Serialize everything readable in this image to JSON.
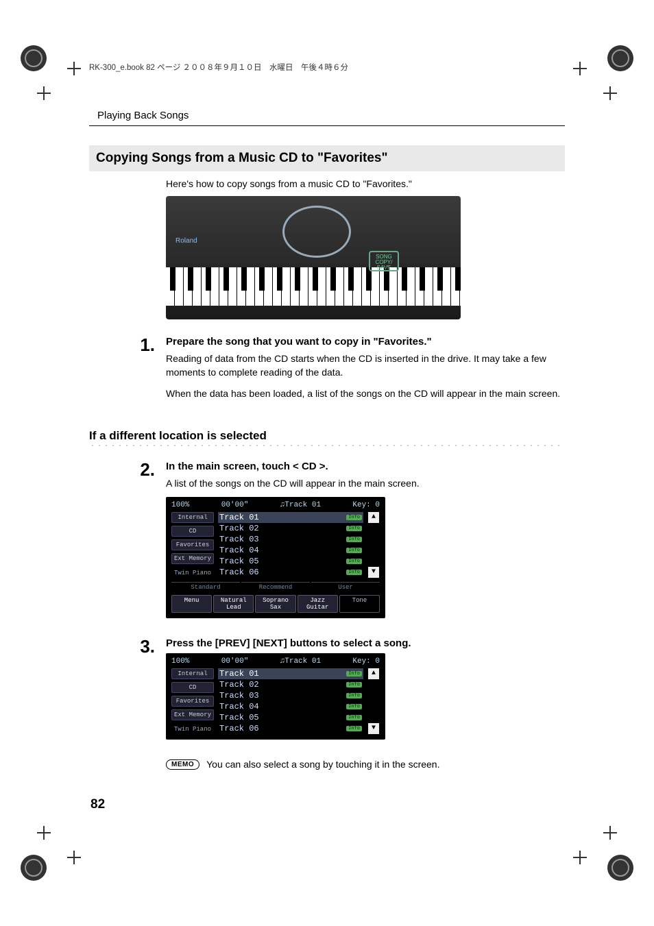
{
  "header_note": "RK-300_e.book  82 ページ  ２００８年９月１０日　水曜日　午後４時６分",
  "running_head": "Playing Back Songs",
  "section_title": "Copying Songs from a Music CD to \"Favorites\"",
  "intro": "Here's how to copy songs from a music CD to \"Favorites.\"",
  "figure": {
    "brand": "Roland",
    "button_line1": "SONG",
    "button_line2": "COPY/\nSAVE"
  },
  "steps": [
    {
      "num": "1.",
      "head": "Prepare the song that you want to copy in \"Favorites.\"",
      "paras": [
        "Reading of data from the CD starts when the CD is inserted in the drive. It may take a few moments to complete reading of the data.",
        "When the data has been loaded, a list of the songs on the CD will appear in the main screen."
      ]
    }
  ],
  "subsection": "If a different location is selected",
  "step2": {
    "num": "2.",
    "head": "In the main screen, touch < CD >.",
    "para": "A list of the songs on the CD will appear in the main screen."
  },
  "step3": {
    "num": "3.",
    "head": "Press the [PREV] [NEXT] buttons to select a song."
  },
  "screenshot_common": {
    "top_left": "100%",
    "top_center": "00'00\"",
    "top_track": "Track 01",
    "top_key": "Key: 0",
    "side_tabs": [
      "Internal",
      "CD",
      "Favorites",
      "Ext Memory"
    ],
    "twin": "Twin Piano",
    "tracks": [
      "Track 01",
      "Track 02",
      "Track 03",
      "Track 04",
      "Track 05",
      "Track 06"
    ],
    "info_label": "Info",
    "bottom_tabs": [
      "Standard",
      "Recommend",
      "User"
    ],
    "bottom_buttons": [
      "Menu",
      "Natural Lead",
      "Soprano Sax",
      "Jazz Guitar",
      "Tone"
    ],
    "arrow_up": "▲",
    "arrow_down": "▼",
    "selected_track_idx": 0,
    "note_icon": "♫"
  },
  "memo": {
    "label": "MEMO",
    "text": "You can also select a song by touching it in the screen."
  },
  "page_number": "82"
}
